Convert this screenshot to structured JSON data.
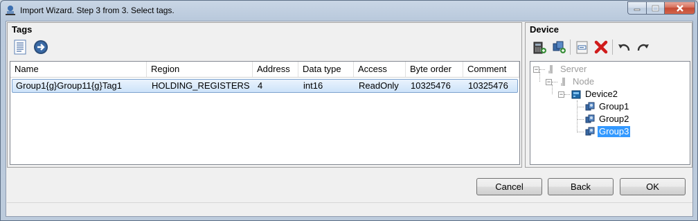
{
  "window": {
    "title": "Import Wizard. Step 3 from 3. Select tags."
  },
  "tags": {
    "title": "Tags",
    "columns": [
      "Name",
      "Region",
      "Address",
      "Data type",
      "Access",
      "Byte order",
      "Comment"
    ],
    "rows": [
      [
        "Group1{g}Group11{g}Tag1",
        "HOLDING_REGISTERS",
        "4",
        "int16",
        "ReadOnly",
        "10325476",
        "10325476"
      ]
    ]
  },
  "device": {
    "title": "Device",
    "tree": {
      "server": "Server",
      "node": "Node",
      "device": "Device2",
      "groups": [
        "Group1",
        "Group2",
        "Group3"
      ],
      "selected": "Group3"
    }
  },
  "buttons": {
    "cancel": "Cancel",
    "back": "Back",
    "ok": "OK"
  },
  "colors": {
    "selection": "#3399ff",
    "close_button": "#c44a33"
  }
}
